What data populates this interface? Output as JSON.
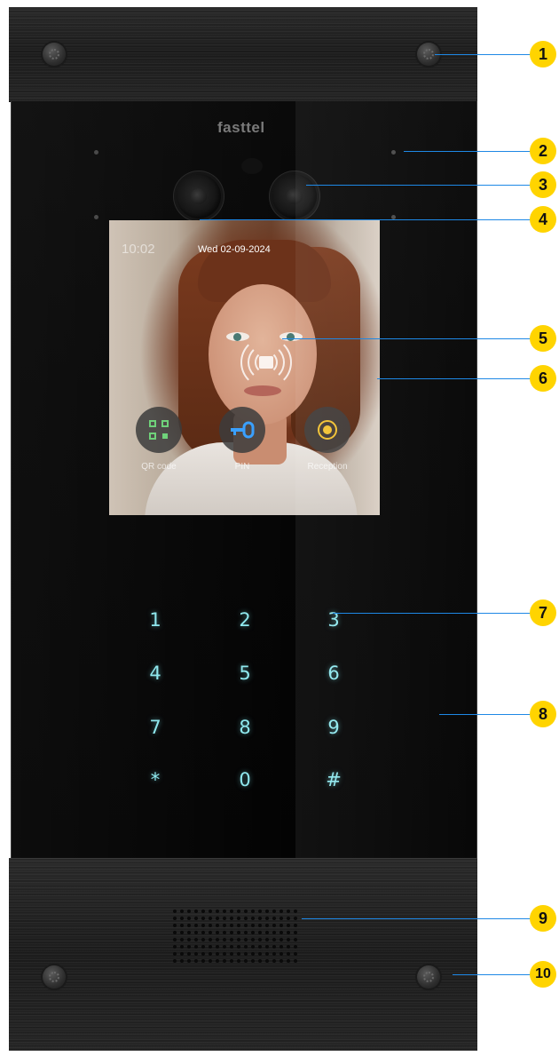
{
  "device": {
    "brand": "fasttel",
    "screen": {
      "clock": "10:02",
      "date": "Wed 02-09-2024",
      "buttons": [
        {
          "label": "QR code",
          "icon": "qr-code-icon",
          "color": "#6fd27a"
        },
        {
          "label": "PIN",
          "icon": "key-icon",
          "color": "#3aa0ff"
        },
        {
          "label": "Reception",
          "icon": "record-icon",
          "color": "#f2c230"
        }
      ]
    },
    "keypad": [
      "1",
      "2",
      "3",
      "4",
      "5",
      "6",
      "7",
      "8",
      "9",
      "*",
      "0",
      "#"
    ],
    "keypad_color": "#8fe8ee"
  },
  "callouts": [
    "1",
    "2",
    "3",
    "4",
    "5",
    "6",
    "7",
    "8",
    "9",
    "10"
  ],
  "callout_colors": {
    "badge": "#ffd400",
    "line": "#1e88e5"
  }
}
